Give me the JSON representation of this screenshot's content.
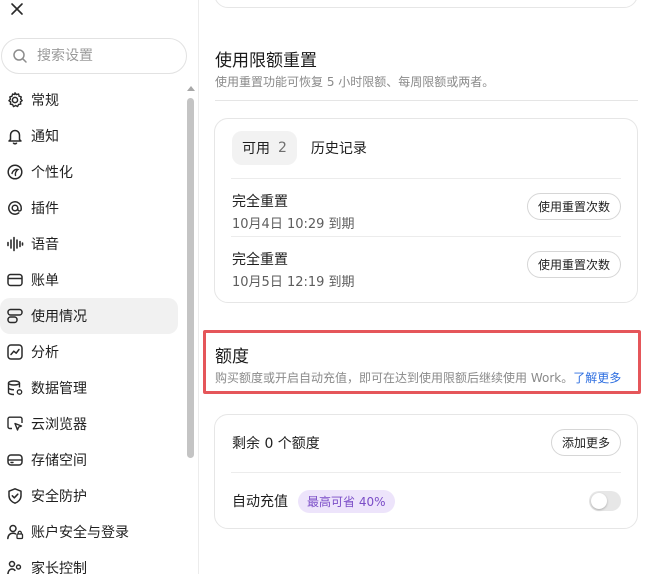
{
  "sidebar": {
    "search_placeholder": "搜索设置",
    "items": [
      {
        "label": "常规",
        "icon": "gear-icon"
      },
      {
        "label": "通知",
        "icon": "bell-icon"
      },
      {
        "label": "个性化",
        "icon": "palette-icon"
      },
      {
        "label": "插件",
        "icon": "at-sign-icon"
      },
      {
        "label": "语音",
        "icon": "waveform-icon"
      },
      {
        "label": "账单",
        "icon": "card-icon"
      },
      {
        "label": "使用情况",
        "icon": "usage-icon",
        "active": true
      },
      {
        "label": "分析",
        "icon": "chart-icon"
      },
      {
        "label": "数据管理",
        "icon": "database-icon"
      },
      {
        "label": "云浏览器",
        "icon": "cloud-browser-icon"
      },
      {
        "label": "存储空间",
        "icon": "storage-icon"
      },
      {
        "label": "安全防护",
        "icon": "shield-icon"
      },
      {
        "label": "账户安全与登录",
        "icon": "user-lock-icon"
      },
      {
        "label": "家长控制",
        "icon": "family-icon"
      }
    ]
  },
  "reset": {
    "title": "使用限额重置",
    "description": "使用重置功能可恢复 5 小时限额、每周限额或两者。",
    "tabs": [
      {
        "label": "可用",
        "count": "2",
        "active": true
      },
      {
        "label": "历史记录"
      }
    ],
    "rows": [
      {
        "title": "完全重置",
        "expiry": "10月4日 10:29 到期",
        "button": "使用重置次数"
      },
      {
        "title": "完全重置",
        "expiry": "10月5日 12:19 到期",
        "button": "使用重置次数"
      }
    ]
  },
  "credits": {
    "title": "额度",
    "description": "购买额度或开启自动充值，即可在达到使用限额后继续使用 Work。",
    "learn_more": "了解更多",
    "remaining": "剩余 0 个额度",
    "add_more": "添加更多",
    "auto_topup_label": "自动充值",
    "savings_badge": "最高可省 40%",
    "auto_topup_enabled": false
  },
  "colors": {
    "highlight": "#e5565a",
    "link": "#2f6fe0",
    "badge_bg": "#ede4fb",
    "badge_text": "#7a4cc7"
  }
}
